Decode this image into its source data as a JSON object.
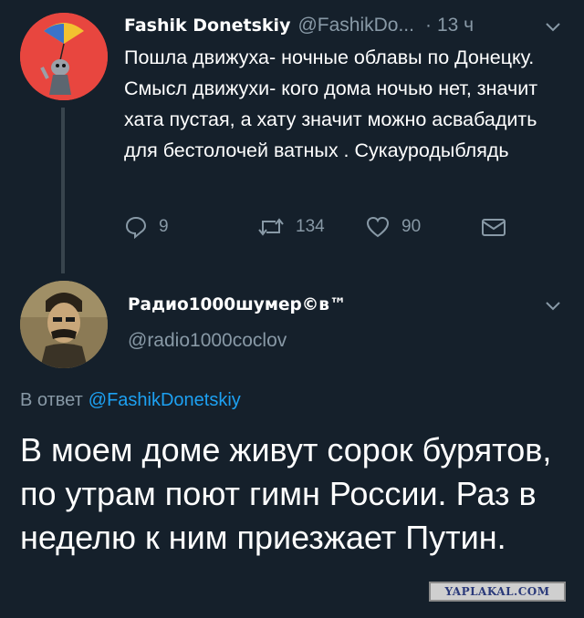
{
  "colors": {
    "background": "#15202b",
    "text_primary": "#ffffff",
    "text_secondary": "#8899a6",
    "link": "#1da1f2",
    "thread_line": "#38444d"
  },
  "tweet1": {
    "avatar_icon": "user-avatar-icon",
    "name": "Fashik Donetskiy",
    "handle": "@FashikDo...",
    "dot": "·",
    "time": "13 ч",
    "body": "Пошла движуха- ночные облавы по Донецку. Смысл движухи- кого дома ночью нет, значит хата пустая, а хату значит можно асвабадить для бестолочей ватных . Сукауродыблядь",
    "actions": {
      "reply_count": "9",
      "retweet_count": "134",
      "like_count": "90"
    }
  },
  "tweet2": {
    "avatar_icon": "user-avatar-icon",
    "name": "Радио1000шумер©в™",
    "handle": "@radio1000coclov",
    "reply_prefix": "В ответ",
    "reply_mention": "@FashikDonetskiy",
    "body": "В моем доме живут сорок бурятов, по утрам поют гимн России. Раз в неделю к ним приезжает Путин."
  },
  "watermark": "YAPLAKAL.COM"
}
